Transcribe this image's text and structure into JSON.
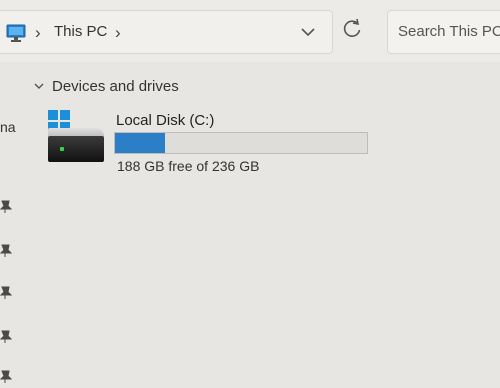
{
  "breadcrumb": {
    "location_label": "This PC",
    "separator": "›"
  },
  "search": {
    "placeholder": "Search This PC"
  },
  "nav": {
    "partial_item_label": "na"
  },
  "devices": {
    "section_label": "Devices and drives",
    "drives": [
      {
        "name": "Local Disk (C:)",
        "free_text": "188 GB free of 236 GB",
        "used_fraction": 0.2
      }
    ]
  },
  "colors": {
    "usage_bar_fill": "#2a7fc7",
    "windows_logo": "#1c8fd9"
  },
  "icons": {
    "location": "this-pc-monitor-icon",
    "dropdown": "chevron-down-icon",
    "refresh": "refresh-icon",
    "section_toggle": "chevron-down-icon",
    "drive": "hard-disk-icon",
    "pin": "pin-icon"
  }
}
